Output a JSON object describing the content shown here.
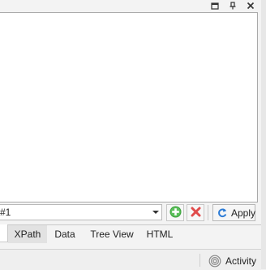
{
  "window": {
    "buttons": [
      {
        "name": "maximize-icon"
      },
      {
        "name": "pin-icon"
      },
      {
        "name": "close-icon"
      }
    ]
  },
  "query": {
    "value": "#1"
  },
  "toolbar": {
    "add_icon": "plus-circle-icon",
    "remove_icon": "delete-x-icon",
    "apply_label": "Apply",
    "apply_icon": "refresh-icon"
  },
  "tabs": [
    {
      "label": ""
    },
    {
      "label": "XPath"
    },
    {
      "label": "Data"
    },
    {
      "label": "Tree View"
    },
    {
      "label": "HTML"
    }
  ],
  "status": {
    "activity_label": "Activity",
    "activity_icon": "activity-icon"
  },
  "colors": {
    "add_green": "#3aa03a",
    "remove_red": "#e04b4b",
    "apply_blue": "#2b7bd6"
  }
}
